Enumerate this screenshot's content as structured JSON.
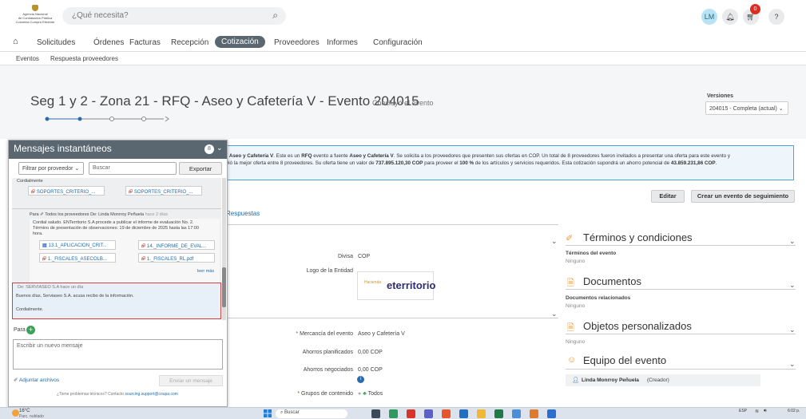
{
  "header": {
    "logo_text": [
      "Agencia Nacional",
      "de Contratación Pública",
      "Colombia Compra Eficiente"
    ],
    "search_placeholder": "¿Qué necesita?",
    "user_initials": "LM",
    "cart_count": "0",
    "help_label": "?"
  },
  "nav": {
    "items": [
      "Solicitudes",
      "Órdenes",
      "Facturas",
      "Recepción",
      "Cotización",
      "Proveedores",
      "Informes",
      "Configuración"
    ],
    "active": "Cotización"
  },
  "breadcrumb": [
    "Eventos",
    "Respuesta proveedores"
  ],
  "event": {
    "title": "Seg 1 y 2 - Zona 21 - RFQ - Aseo y Cafetería V - Evento 204015",
    "status": "Concluyó el evento",
    "versions_label": "Versiones",
    "versions_value": "204015 - Completa (actual)"
  },
  "banner": {
    "line1_prefix": "- ",
    "line1_bold": "Aseo y Cafetería V",
    "line1_mid": ". Este es un ",
    "line1_bold2": "RFQ",
    "line1_mid2": " evento a fuente ",
    "line1_bold3": "Aseo y Cafetería V",
    "line1_rest": ". Se solicita a los proveedores que presenten sus ofertas en COP. Un total de 8 proveedores fueron invitados a presentar una oferta para este evento y",
    "line2_a": "vió la mejor oferta entre 8 proveedores. Su oferta tiene un valor de ",
    "line2_b": "737.895.120,30 COP",
    "line2_c": " para proveer el ",
    "line2_d": "100 %",
    "line2_e": " de los artículos y servicios requeridos. Esta cotización supondrá un ahorro potencial de ",
    "line2_f": "43.859.231,86 COP",
    "line2_g": "."
  },
  "actions": {
    "edit": "Editar",
    "followup": "Crear un evento de seguimiento"
  },
  "tab_label": "Respuestas",
  "fields": {
    "divisa_label": "Divisa",
    "divisa_value": "COP",
    "logo_label": "Logo de la Entidad",
    "logo_brand": "eterritorio",
    "logo_sub": "Hacienda",
    "mercancia_label": "Mercancía del evento",
    "mercancia_value": "Aseo y Cafetería V",
    "ahorros_plan_label": "Ahorros planificados",
    "ahorros_plan_value": "0,00 COP",
    "ahorros_neg_label": "Ahorros negociados",
    "ahorros_neg_value": "0,00 COP",
    "grupos_label": "Grupos de contenido",
    "grupos_value": "Todos"
  },
  "right_panels": {
    "terminos_title": "Términos y condiciones",
    "terminos_sub": "Términos del evento",
    "terminos_val": "Ninguno",
    "documentos_title": "Documentos",
    "documentos_sub": "Documentos relacionados",
    "documentos_val": "Ninguno",
    "objetos_title": "Objetos personalizados",
    "objetos_val": "Ninguno",
    "equipo_title": "Equipo del evento",
    "equipo_member": "Linda Monrroy Peñuela",
    "equipo_role": "(Creador)"
  },
  "chat": {
    "title": "Mensajes instantáneos",
    "badge": "8",
    "filter": "Filtrar por proveedor",
    "search_placeholder": "Buscar",
    "export": "Exportar",
    "top_text": "Cordialmente",
    "top_attachments": [
      "SOPORTES_CRITERIO_...",
      "SOPORTES_CRITERIO_..."
    ],
    "msg2_header_a": "Para",
    "msg2_header_b": "Todos los proveedores De: Linda Monrroy Peñuela",
    "msg2_time": "hace 2 días",
    "msg2_body": [
      "Cordial saludo. ENTerritorio S.A procede a publicar el informe de evaluación No. 2.",
      "Término de presentación de observaciones: 19 de diciembre de 2025 hasta las 17:00",
      "hora."
    ],
    "msg2_attachments": [
      "13.1_APLICACION_CRIT...",
      "14._INFORME_DE_EVAL...",
      "1._FISCALES_ASECOLB...",
      "1._FISCALES_RL.pdf"
    ],
    "read_more": "leer más",
    "msg3_header": "De: SERVIASEO S.A hace un día",
    "msg3_body": "Buenos días, Serviaseo S.A. acusa recibo de la información.",
    "msg3_sign": "Cordialmente.",
    "to_label": "Para",
    "new_msg_placeholder": "Escribir un nuevo mensaje",
    "attach_files": "Adjuntar archivos",
    "send": "Enviar un mensaje",
    "help_a": "¿Tiene problemas técnicos? Contacto ",
    "help_link": "sourcing.support@coupa.com"
  },
  "taskbar": {
    "temp": "16°C",
    "weather": "Parc. nublado",
    "search": "Buscar",
    "lang": "ESP",
    "time": "6:02 p."
  }
}
